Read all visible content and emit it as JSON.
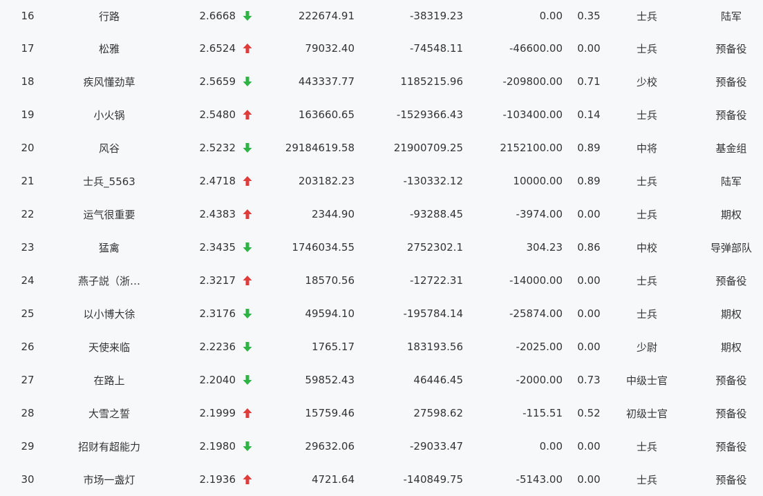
{
  "colors": {
    "up": "#e03c3c",
    "down": "#2fb344",
    "text": "#333333",
    "background": "#f7f8fa"
  },
  "rows": [
    {
      "rank": "16",
      "name": "行路",
      "score": "2.6668",
      "trend": "down",
      "trend_icon": "green-down-arrow-icon",
      "v1": "222674.91",
      "v2": "-38319.23",
      "v3": "0.00",
      "ratio": "0.35",
      "title": "士兵",
      "group": "陆军"
    },
    {
      "rank": "17",
      "name": "松雅",
      "score": "2.6524",
      "trend": "up",
      "trend_icon": "red-up-arrow-icon",
      "v1": "79032.40",
      "v2": "-74548.11",
      "v3": "-46600.00",
      "ratio": "0.00",
      "title": "士兵",
      "group": "预备役"
    },
    {
      "rank": "18",
      "name": "疾风懂劲草",
      "score": "2.5659",
      "trend": "down",
      "trend_icon": "green-down-arrow-icon",
      "v1": "443337.77",
      "v2": "1185215.96",
      "v3": "-209800.00",
      "ratio": "0.71",
      "title": "少校",
      "group": "预备役"
    },
    {
      "rank": "19",
      "name": "小火锅",
      "score": "2.5480",
      "trend": "up",
      "trend_icon": "red-up-arrow-icon",
      "v1": "163660.65",
      "v2": "-1529366.43",
      "v3": "-103400.00",
      "ratio": "0.14",
      "title": "士兵",
      "group": "预备役"
    },
    {
      "rank": "20",
      "name": "风谷",
      "score": "2.5232",
      "trend": "down",
      "trend_icon": "green-down-arrow-icon",
      "v1": "29184619.58",
      "v2": "21900709.25",
      "v3": "2152100.00",
      "ratio": "0.89",
      "title": "中将",
      "group": "基金组"
    },
    {
      "rank": "21",
      "name": "士兵_5563",
      "score": "2.4718",
      "trend": "up",
      "trend_icon": "red-up-arrow-icon",
      "v1": "203182.23",
      "v2": "-130332.12",
      "v3": "10000.00",
      "ratio": "0.89",
      "title": "士兵",
      "group": "陆军"
    },
    {
      "rank": "22",
      "name": "运气很重要",
      "score": "2.4383",
      "trend": "up",
      "trend_icon": "red-up-arrow-icon",
      "v1": "2344.90",
      "v2": "-93288.45",
      "v3": "-3974.00",
      "ratio": "0.00",
      "title": "士兵",
      "group": "期权"
    },
    {
      "rank": "23",
      "name": "猛禽",
      "score": "2.3435",
      "trend": "down",
      "trend_icon": "green-down-arrow-icon",
      "v1": "1746034.55",
      "v2": "2752302.1",
      "v3": "304.23",
      "ratio": "0.86",
      "title": "中校",
      "group": "导弹部队"
    },
    {
      "rank": "24",
      "name": "燕子説（浙…",
      "score": "2.3217",
      "trend": "up",
      "trend_icon": "red-up-arrow-icon",
      "v1": "18570.56",
      "v2": "-12722.31",
      "v3": "-14000.00",
      "ratio": "0.00",
      "title": "士兵",
      "group": "预备役"
    },
    {
      "rank": "25",
      "name": "以小博大徐",
      "score": "2.3176",
      "trend": "down",
      "trend_icon": "green-down-arrow-icon",
      "v1": "49594.10",
      "v2": "-195784.14",
      "v3": "-25874.00",
      "ratio": "0.00",
      "title": "士兵",
      "group": "期权"
    },
    {
      "rank": "26",
      "name": "天使来临",
      "score": "2.2236",
      "trend": "down",
      "trend_icon": "green-down-arrow-icon",
      "v1": "1765.17",
      "v2": "183193.56",
      "v3": "-2025.00",
      "ratio": "0.00",
      "title": "少尉",
      "group": "期权"
    },
    {
      "rank": "27",
      "name": "在路上",
      "score": "2.2040",
      "trend": "down",
      "trend_icon": "green-down-arrow-icon",
      "v1": "59852.43",
      "v2": "46446.45",
      "v3": "-2000.00",
      "ratio": "0.73",
      "title": "中级士官",
      "group": "预备役"
    },
    {
      "rank": "28",
      "name": "大雪之誓",
      "score": "2.1999",
      "trend": "up",
      "trend_icon": "red-up-arrow-icon",
      "v1": "15759.46",
      "v2": "27598.62",
      "v3": "-115.51",
      "ratio": "0.52",
      "title": "初级士官",
      "group": "预备役"
    },
    {
      "rank": "29",
      "name": "招财有超能力",
      "score": "2.1980",
      "trend": "down",
      "trend_icon": "green-down-arrow-icon",
      "v1": "29632.06",
      "v2": "-29033.47",
      "v3": "0.00",
      "ratio": "0.00",
      "title": "士兵",
      "group": "预备役"
    },
    {
      "rank": "30",
      "name": "市场一盏灯",
      "score": "2.1936",
      "trend": "up",
      "trend_icon": "red-up-arrow-icon",
      "v1": "4721.64",
      "v2": "-140849.75",
      "v3": "-5143.00",
      "ratio": "0.00",
      "title": "士兵",
      "group": "预备役"
    }
  ]
}
